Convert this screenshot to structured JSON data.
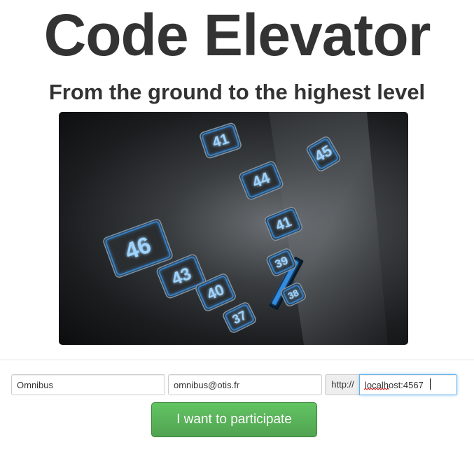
{
  "header": {
    "title": "Code Elevator",
    "subtitle": "From the ground to the highest level"
  },
  "hero_image": {
    "subject": "elevator-keypad",
    "button_labels": [
      "41",
      "44",
      "41",
      "46",
      "43",
      "40",
      "37",
      "39",
      "38",
      "45"
    ]
  },
  "form": {
    "name_value": "Omnibus",
    "email_value": "omnibus@otis.fr",
    "url_prefix": "http://",
    "url_value": "localhost:4567",
    "submit_label": "I want to participate"
  },
  "colors": {
    "button_green": "#5bb75b",
    "focus_blue": "#66afe9",
    "key_glow": "#3aa0ff"
  }
}
